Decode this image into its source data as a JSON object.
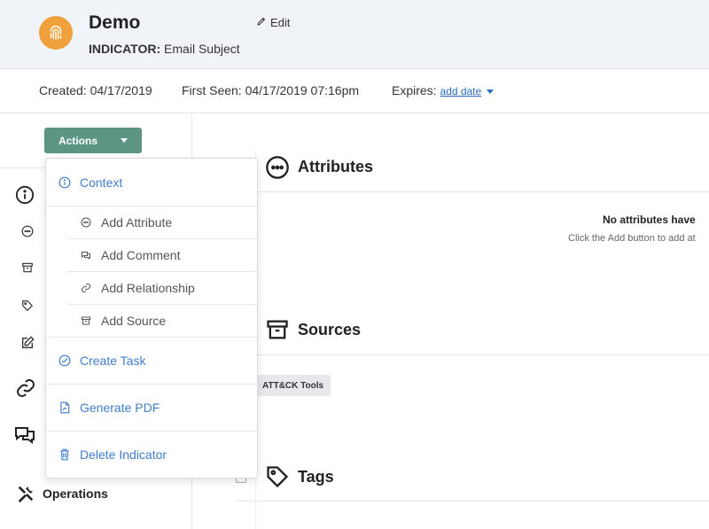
{
  "header": {
    "title": "Demo",
    "subtitle_label": "INDICATOR:",
    "subtitle_value": "Email Subject",
    "edit_label": "Edit",
    "logo_color": "#f0a13c"
  },
  "meta": {
    "created_label": "Created:",
    "created_value": "04/17/2019",
    "first_seen_label": "First Seen:",
    "first_seen_value": "04/17/2019 07:16pm",
    "expires_label": "Expires:",
    "expires_link": "add date"
  },
  "sidebar": {
    "actions_label": "Actions",
    "operations_label": "Operations",
    "accent_color": "#5d9585"
  },
  "dropdown": {
    "items": [
      {
        "label": "Context",
        "icon": "info-icon"
      },
      {
        "label": "Add Attribute",
        "icon": "ellipsis-circle-icon"
      },
      {
        "label": "Add Comment",
        "icon": "comment-icon"
      },
      {
        "label": "Add Relationship",
        "icon": "link-icon"
      },
      {
        "label": "Add Source",
        "icon": "archive-icon"
      },
      {
        "label": "Create Task",
        "icon": "check-circle-icon"
      },
      {
        "label": "Generate PDF",
        "icon": "pdf-icon"
      },
      {
        "label": "Delete Indicator",
        "icon": "trash-icon"
      }
    ],
    "link_color": "#3f7ecf"
  },
  "main": {
    "attributes_title": "Attributes",
    "attributes_empty_title": "No attributes have",
    "attributes_empty_sub": "Click the Add button to add at",
    "sources_title": "Sources",
    "source_chip": "ATT&CK Tools",
    "tags_title": "Tags"
  }
}
